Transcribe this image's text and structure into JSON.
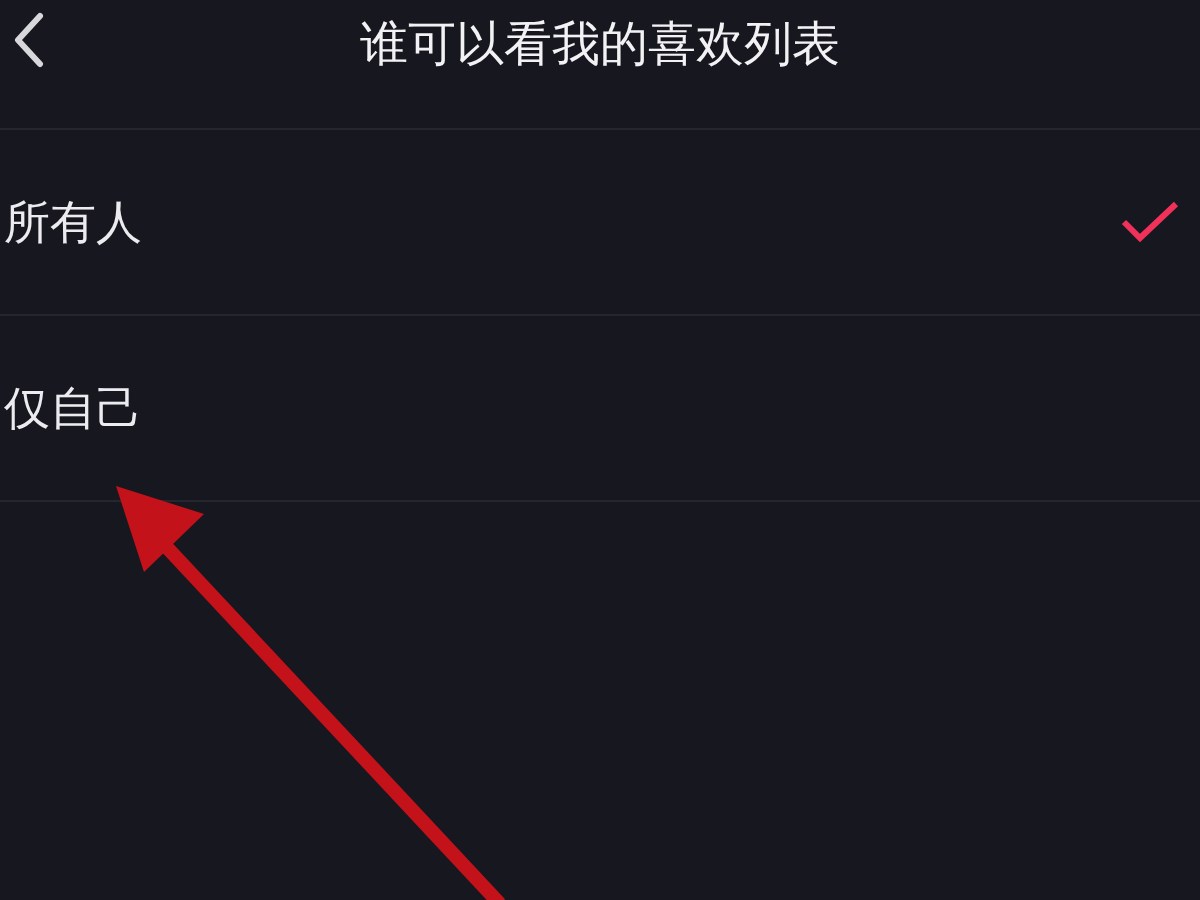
{
  "header": {
    "title": "谁可以看我的喜欢列表"
  },
  "options": [
    {
      "label": "所有人",
      "selected": true
    },
    {
      "label": "仅自己",
      "selected": false
    }
  ]
}
